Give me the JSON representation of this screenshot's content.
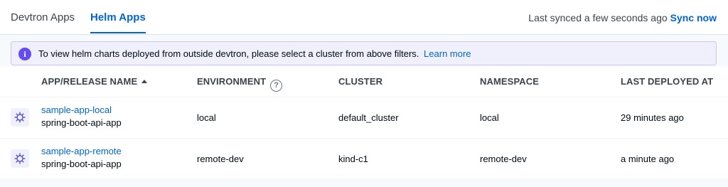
{
  "tabs": [
    {
      "label": "Devtron Apps",
      "active": false
    },
    {
      "label": "Helm Apps",
      "active": true
    }
  ],
  "sync": {
    "status": "Last synced a few seconds ago",
    "action": "Sync now"
  },
  "info_bar": {
    "icon": "info-icon",
    "message": "To view helm charts deployed from outside devtron, please select a cluster from above filters.",
    "link": "Learn more"
  },
  "table": {
    "columns": {
      "app": "APP/RELEASE NAME",
      "environment": "ENVIRONMENT",
      "cluster": "CLUSTER",
      "namespace": "NAMESPACE",
      "last_deployed": "LAST DEPLOYED AT"
    },
    "help_icon": "?",
    "rows": [
      {
        "app_name": "sample-app-local",
        "chart_name": "spring-boot-api-app",
        "environment": "local",
        "cluster": "default_cluster",
        "namespace": "local",
        "last_deployed": "29 minutes ago"
      },
      {
        "app_name": "sample-app-remote",
        "chart_name": "spring-boot-api-app",
        "environment": "remote-dev",
        "cluster": "kind-c1",
        "namespace": "remote-dev",
        "last_deployed": "a minute ago"
      }
    ]
  },
  "colors": {
    "accent": "#0066cc",
    "info_bg": "#f0f0fd",
    "info_icon": "#664bee"
  }
}
